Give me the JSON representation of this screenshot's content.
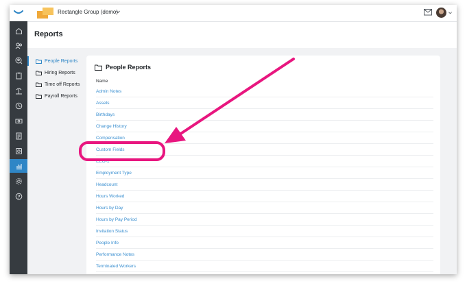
{
  "colors": {
    "accent": "#2f86c6",
    "link": "#3a8fd0",
    "rail": "#363b40",
    "highlight": "#e8167f"
  },
  "topbar": {
    "org_name": "Rectangle Group (demo)"
  },
  "page": {
    "title": "Reports"
  },
  "subnav": {
    "items": [
      {
        "label": "People Reports"
      },
      {
        "label": "Hiring Reports"
      },
      {
        "label": "Time off Reports"
      },
      {
        "label": "Payroll Reports"
      }
    ]
  },
  "card": {
    "title": "People Reports",
    "column_header": "Name",
    "rows": [
      "Admin Notes",
      "Assets",
      "Birthdays",
      "Change History",
      "Compensation",
      "Custom Fields",
      "EEO-1",
      "Employment Type",
      "Headcount",
      "Hours Worked",
      "Hours by Day",
      "Hours by Pay Period",
      "Invitation Status",
      "People Info",
      "Performance Notes",
      "Terminated Workers"
    ]
  },
  "rail_icons": [
    "home-icon",
    "people-icon",
    "search-person-icon",
    "clipboard-icon",
    "island-icon",
    "clock-icon",
    "money-icon",
    "document-icon",
    "badge-icon",
    "reports-icon",
    "gear-icon",
    "help-icon"
  ]
}
